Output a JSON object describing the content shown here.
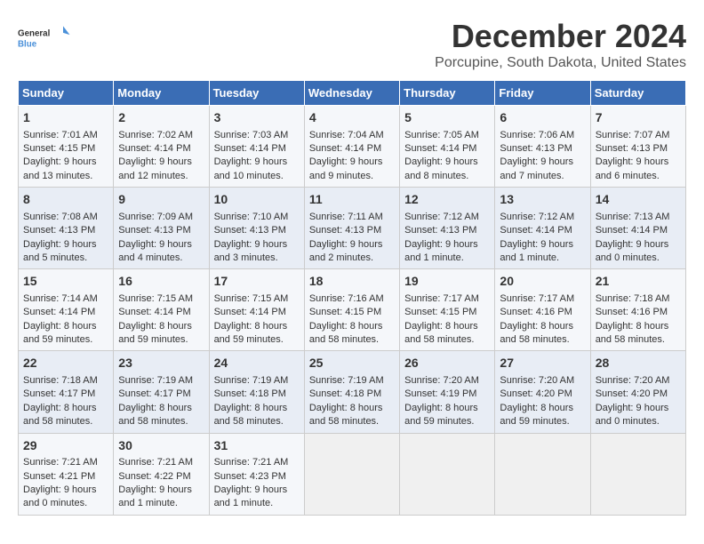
{
  "logo": {
    "text_general": "General",
    "text_blue": "Blue"
  },
  "title": "December 2024",
  "location": "Porcupine, South Dakota, United States",
  "weekdays": [
    "Sunday",
    "Monday",
    "Tuesday",
    "Wednesday",
    "Thursday",
    "Friday",
    "Saturday"
  ],
  "weeks": [
    [
      {
        "day": "1",
        "info": "Sunrise: 7:01 AM\nSunset: 4:15 PM\nDaylight: 9 hours\nand 13 minutes."
      },
      {
        "day": "2",
        "info": "Sunrise: 7:02 AM\nSunset: 4:14 PM\nDaylight: 9 hours\nand 12 minutes."
      },
      {
        "day": "3",
        "info": "Sunrise: 7:03 AM\nSunset: 4:14 PM\nDaylight: 9 hours\nand 10 minutes."
      },
      {
        "day": "4",
        "info": "Sunrise: 7:04 AM\nSunset: 4:14 PM\nDaylight: 9 hours\nand 9 minutes."
      },
      {
        "day": "5",
        "info": "Sunrise: 7:05 AM\nSunset: 4:14 PM\nDaylight: 9 hours\nand 8 minutes."
      },
      {
        "day": "6",
        "info": "Sunrise: 7:06 AM\nSunset: 4:13 PM\nDaylight: 9 hours\nand 7 minutes."
      },
      {
        "day": "7",
        "info": "Sunrise: 7:07 AM\nSunset: 4:13 PM\nDaylight: 9 hours\nand 6 minutes."
      }
    ],
    [
      {
        "day": "8",
        "info": "Sunrise: 7:08 AM\nSunset: 4:13 PM\nDaylight: 9 hours\nand 5 minutes."
      },
      {
        "day": "9",
        "info": "Sunrise: 7:09 AM\nSunset: 4:13 PM\nDaylight: 9 hours\nand 4 minutes."
      },
      {
        "day": "10",
        "info": "Sunrise: 7:10 AM\nSunset: 4:13 PM\nDaylight: 9 hours\nand 3 minutes."
      },
      {
        "day": "11",
        "info": "Sunrise: 7:11 AM\nSunset: 4:13 PM\nDaylight: 9 hours\nand 2 minutes."
      },
      {
        "day": "12",
        "info": "Sunrise: 7:12 AM\nSunset: 4:13 PM\nDaylight: 9 hours\nand 1 minute."
      },
      {
        "day": "13",
        "info": "Sunrise: 7:12 AM\nSunset: 4:14 PM\nDaylight: 9 hours\nand 1 minute."
      },
      {
        "day": "14",
        "info": "Sunrise: 7:13 AM\nSunset: 4:14 PM\nDaylight: 9 hours\nand 0 minutes."
      }
    ],
    [
      {
        "day": "15",
        "info": "Sunrise: 7:14 AM\nSunset: 4:14 PM\nDaylight: 8 hours\nand 59 minutes."
      },
      {
        "day": "16",
        "info": "Sunrise: 7:15 AM\nSunset: 4:14 PM\nDaylight: 8 hours\nand 59 minutes."
      },
      {
        "day": "17",
        "info": "Sunrise: 7:15 AM\nSunset: 4:14 PM\nDaylight: 8 hours\nand 59 minutes."
      },
      {
        "day": "18",
        "info": "Sunrise: 7:16 AM\nSunset: 4:15 PM\nDaylight: 8 hours\nand 58 minutes."
      },
      {
        "day": "19",
        "info": "Sunrise: 7:17 AM\nSunset: 4:15 PM\nDaylight: 8 hours\nand 58 minutes."
      },
      {
        "day": "20",
        "info": "Sunrise: 7:17 AM\nSunset: 4:16 PM\nDaylight: 8 hours\nand 58 minutes."
      },
      {
        "day": "21",
        "info": "Sunrise: 7:18 AM\nSunset: 4:16 PM\nDaylight: 8 hours\nand 58 minutes."
      }
    ],
    [
      {
        "day": "22",
        "info": "Sunrise: 7:18 AM\nSunset: 4:17 PM\nDaylight: 8 hours\nand 58 minutes."
      },
      {
        "day": "23",
        "info": "Sunrise: 7:19 AM\nSunset: 4:17 PM\nDaylight: 8 hours\nand 58 minutes."
      },
      {
        "day": "24",
        "info": "Sunrise: 7:19 AM\nSunset: 4:18 PM\nDaylight: 8 hours\nand 58 minutes."
      },
      {
        "day": "25",
        "info": "Sunrise: 7:19 AM\nSunset: 4:18 PM\nDaylight: 8 hours\nand 58 minutes."
      },
      {
        "day": "26",
        "info": "Sunrise: 7:20 AM\nSunset: 4:19 PM\nDaylight: 8 hours\nand 59 minutes."
      },
      {
        "day": "27",
        "info": "Sunrise: 7:20 AM\nSunset: 4:20 PM\nDaylight: 8 hours\nand 59 minutes."
      },
      {
        "day": "28",
        "info": "Sunrise: 7:20 AM\nSunset: 4:20 PM\nDaylight: 9 hours\nand 0 minutes."
      }
    ],
    [
      {
        "day": "29",
        "info": "Sunrise: 7:21 AM\nSunset: 4:21 PM\nDaylight: 9 hours\nand 0 minutes."
      },
      {
        "day": "30",
        "info": "Sunrise: 7:21 AM\nSunset: 4:22 PM\nDaylight: 9 hours\nand 1 minute."
      },
      {
        "day": "31",
        "info": "Sunrise: 7:21 AM\nSunset: 4:23 PM\nDaylight: 9 hours\nand 1 minute."
      },
      {
        "day": "",
        "info": ""
      },
      {
        "day": "",
        "info": ""
      },
      {
        "day": "",
        "info": ""
      },
      {
        "day": "",
        "info": ""
      }
    ]
  ]
}
